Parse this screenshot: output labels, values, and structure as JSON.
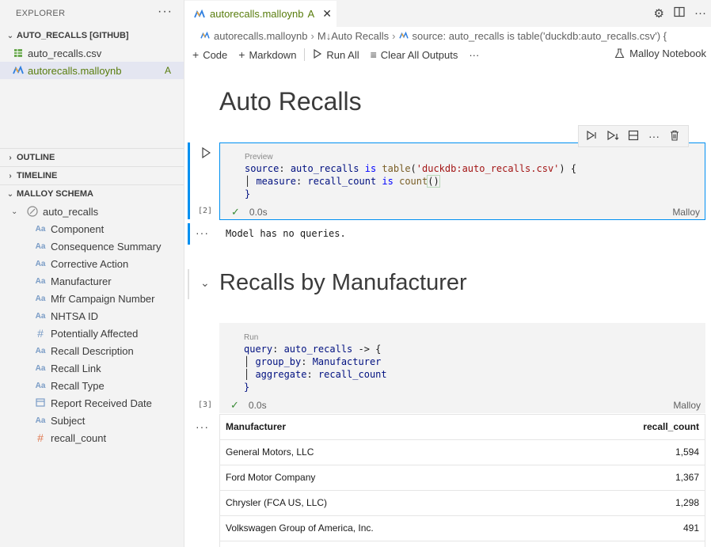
{
  "sidebar": {
    "header": "EXPLORER",
    "more": "···",
    "repo_title": "AUTO_RECALLS [GITHUB]",
    "files": [
      {
        "name": "auto_recalls.csv",
        "icon": "csv-file-icon",
        "badge": ""
      },
      {
        "name": "autorecalls.malloynb",
        "icon": "malloy-icon",
        "badge": "A"
      }
    ],
    "sections": {
      "outline": "OUTLINE",
      "timeline": "TIMELINE",
      "schema": "MALLOY SCHEMA"
    },
    "schema_root": "auto_recalls",
    "fields": [
      {
        "name": "Component",
        "type": "Aa"
      },
      {
        "name": "Consequence Summary",
        "type": "Aa"
      },
      {
        "name": "Corrective Action",
        "type": "Aa"
      },
      {
        "name": "Manufacturer",
        "type": "Aa"
      },
      {
        "name": "Mfr Campaign Number",
        "type": "Aa"
      },
      {
        "name": "NHTSA ID",
        "type": "Aa"
      },
      {
        "name": "Potentially Affected",
        "type": "#"
      },
      {
        "name": "Recall Description",
        "type": "Aa"
      },
      {
        "name": "Recall Link",
        "type": "Aa"
      },
      {
        "name": "Recall Type",
        "type": "Aa"
      },
      {
        "name": "Report Received Date",
        "type": "date"
      },
      {
        "name": "Subject",
        "type": "Aa"
      },
      {
        "name": "recall_count",
        "type": "measure"
      }
    ]
  },
  "editor": {
    "tab": {
      "label": "autorecalls.malloynb",
      "badge": "A"
    },
    "breadcrumb": {
      "file": "autorecalls.malloynb",
      "heading": "M↓Auto Recalls",
      "symbol": "source: auto_recalls is table('duckdb:auto_recalls.csv') {"
    },
    "toolbar": {
      "code": "Code",
      "markdown": "Markdown",
      "run_all": "Run All",
      "clear_outputs": "Clear All Outputs",
      "more": "···",
      "kernel": "Malloy Notebook"
    },
    "heading1": "Auto Recalls",
    "cell1": {
      "hint": "Preview",
      "exec_count": "[2]",
      "time": "0.0s",
      "lang": "Malloy",
      "output": "Model has no queries."
    },
    "heading2": "Recalls by Manufacturer",
    "cell2": {
      "hint": "Run",
      "exec_count": "[3]",
      "time": "0.0s",
      "lang": "Malloy"
    },
    "table": {
      "headers": [
        "Manufacturer",
        "recall_count"
      ],
      "rows": [
        [
          "General Motors, LLC",
          "1,594"
        ],
        [
          "Ford Motor Company",
          "1,367"
        ],
        [
          "Chrysler (FCA US, LLC)",
          "1,298"
        ],
        [
          "Volkswagen Group of America, Inc.",
          "491"
        ]
      ]
    }
  }
}
